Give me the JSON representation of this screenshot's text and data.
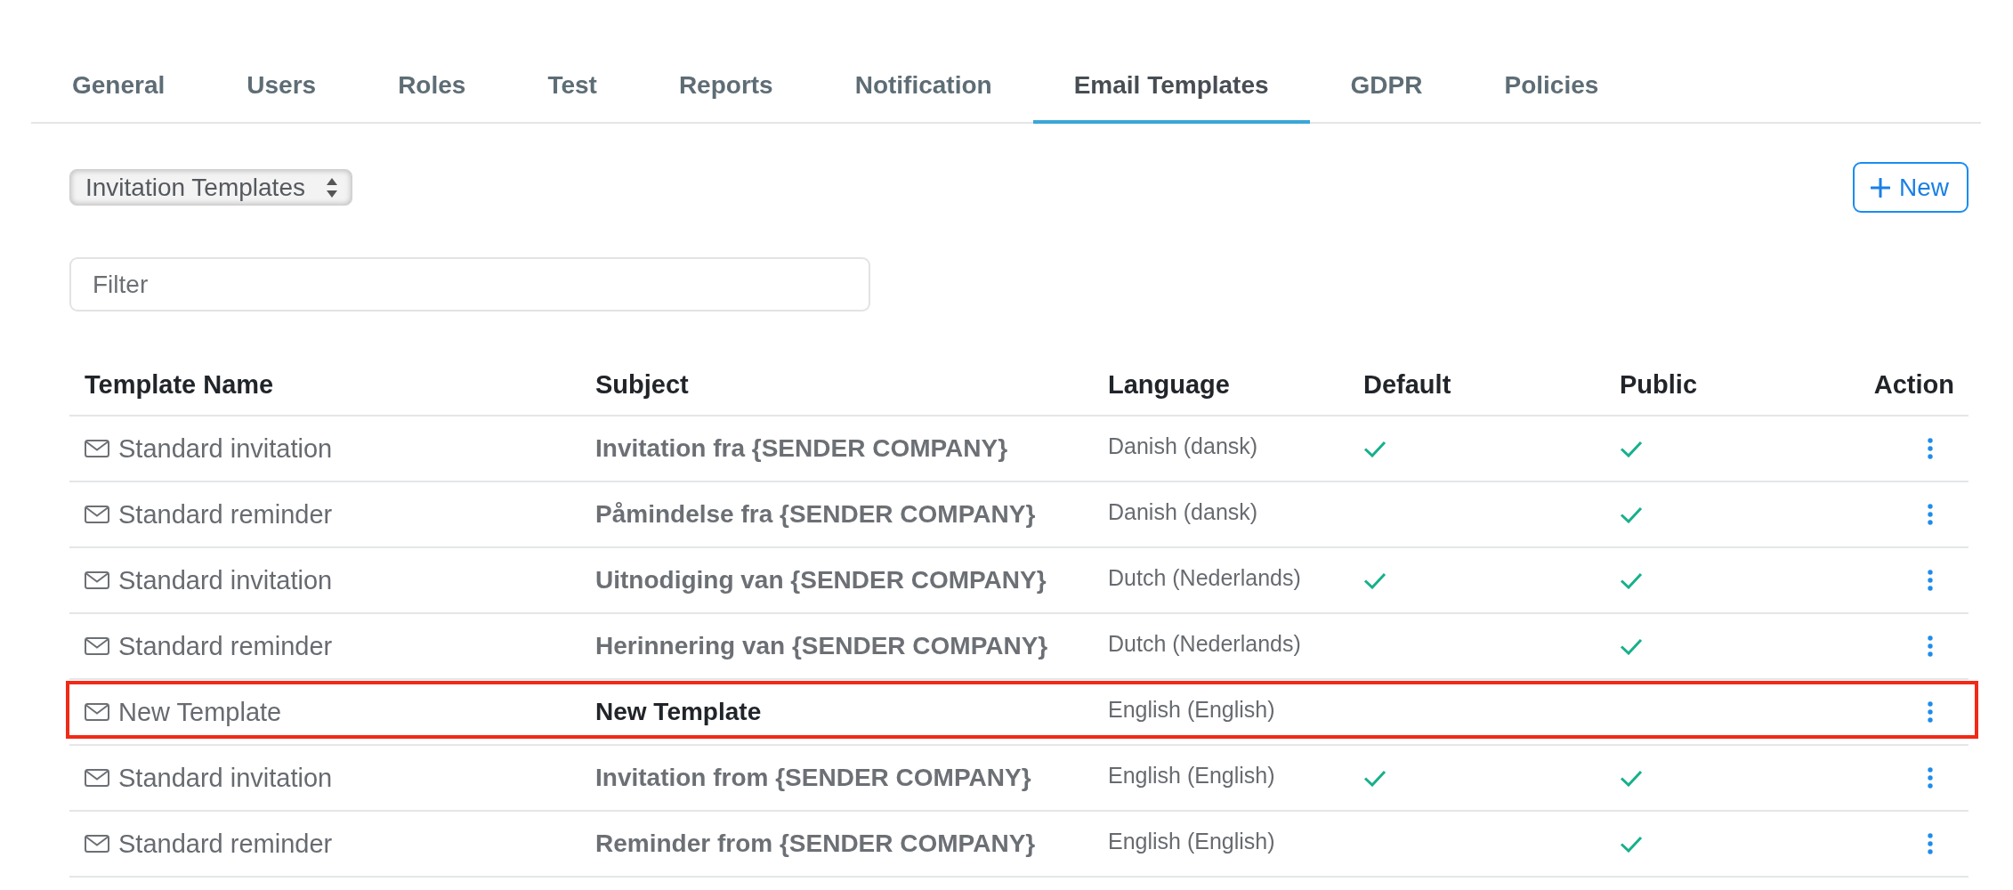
{
  "tabs": [
    {
      "label": "General",
      "selected": false
    },
    {
      "label": "Users",
      "selected": false
    },
    {
      "label": "Roles",
      "selected": false
    },
    {
      "label": "Test",
      "selected": false
    },
    {
      "label": "Reports",
      "selected": false
    },
    {
      "label": "Notification",
      "selected": false
    },
    {
      "label": "Email Templates",
      "selected": true
    },
    {
      "label": "GDPR",
      "selected": false
    },
    {
      "label": "Policies",
      "selected": false
    }
  ],
  "template_select": {
    "value": "Invitation Templates"
  },
  "new_button": {
    "label": "New"
  },
  "filter": {
    "placeholder": "Filter"
  },
  "table": {
    "columns": [
      "Template Name",
      "Subject",
      "Language",
      "Default",
      "Public",
      "Action"
    ],
    "rows": [
      {
        "name": "Standard invitation",
        "subject": "Invitation fra {SENDER COMPANY}",
        "language": "Danish (dansk)",
        "default": true,
        "public": true,
        "highlighted": false
      },
      {
        "name": "Standard reminder",
        "subject": "Påmindelse fra {SENDER COMPANY}",
        "language": "Danish (dansk)",
        "default": false,
        "public": true,
        "highlighted": false
      },
      {
        "name": "Standard invitation",
        "subject": "Uitnodiging van {SENDER COMPANY}",
        "language": "Dutch (Nederlands)",
        "default": true,
        "public": true,
        "highlighted": false
      },
      {
        "name": "Standard reminder",
        "subject": "Herinnering van {SENDER COMPANY}",
        "language": "Dutch (Nederlands)",
        "default": false,
        "public": true,
        "highlighted": false
      },
      {
        "name": "New Template",
        "subject": "New Template",
        "language": "English (English)",
        "default": false,
        "public": false,
        "highlighted": true
      },
      {
        "name": "Standard invitation",
        "subject": "Invitation from {SENDER COMPANY}",
        "language": "English (English)",
        "default": true,
        "public": true,
        "highlighted": false
      },
      {
        "name": "Standard reminder",
        "subject": "Reminder from {SENDER COMPANY}",
        "language": "English (English)",
        "default": false,
        "public": true,
        "highlighted": false
      }
    ]
  }
}
